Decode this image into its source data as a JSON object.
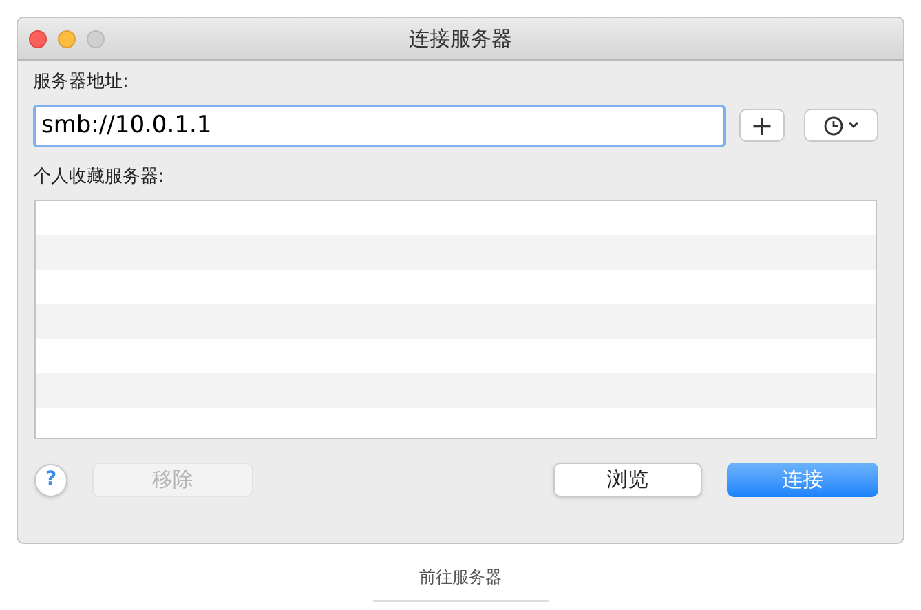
{
  "window": {
    "title": "连接服务器"
  },
  "address": {
    "label": "服务器地址:",
    "value": "smb://10.0.1.1"
  },
  "add_button": {
    "label": "+"
  },
  "favorites": {
    "label": "个人收藏服务器:"
  },
  "buttons": [
    {
      "kind": "help",
      "label": "?",
      "disabled": false
    },
    {
      "kind": "plain",
      "label": "移除",
      "disabled": true
    },
    {
      "kind": "plain",
      "label": "浏览",
      "disabled": false
    },
    {
      "kind": "default",
      "label": "连接",
      "disabled": false
    }
  ],
  "caption": "前往服务器"
}
